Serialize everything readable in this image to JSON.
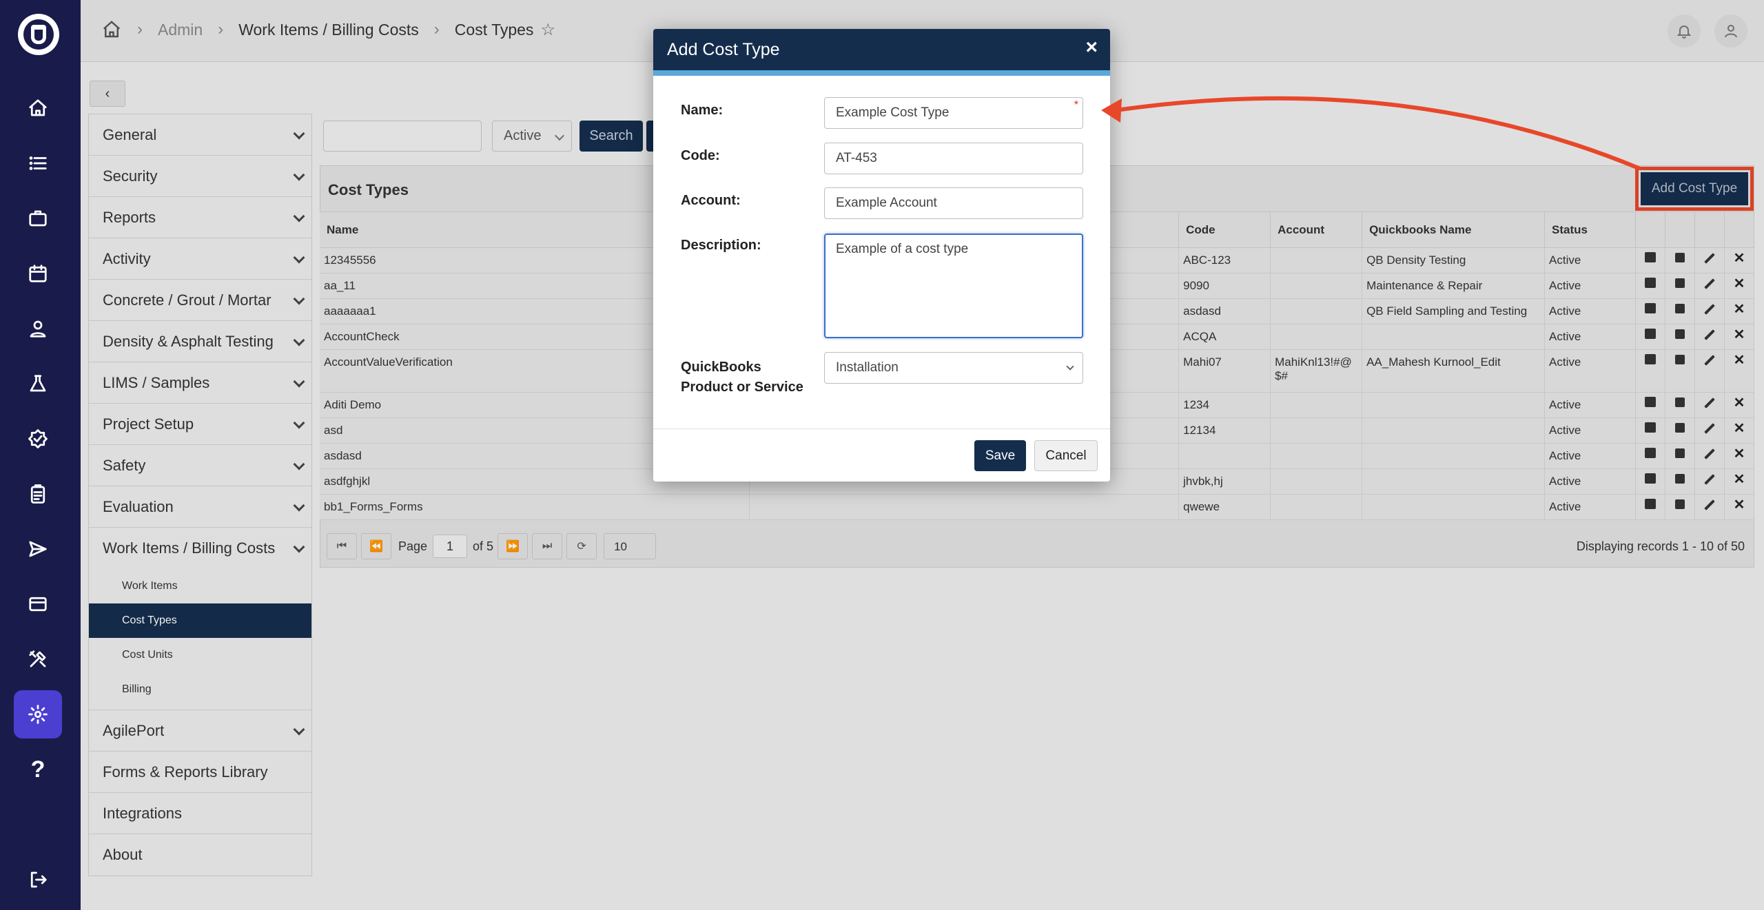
{
  "nav": {
    "items": [
      {
        "icon": "home-icon"
      },
      {
        "icon": "list-icon"
      },
      {
        "icon": "briefcase-icon"
      },
      {
        "icon": "calendar-icon"
      },
      {
        "icon": "person-badge-icon"
      },
      {
        "icon": "flask-icon"
      },
      {
        "icon": "check-badge-icon"
      },
      {
        "icon": "clipboard-icon"
      },
      {
        "icon": "send-icon"
      },
      {
        "icon": "credit-card-icon"
      },
      {
        "icon": "tools-icon"
      },
      {
        "icon": "gear-icon"
      },
      {
        "icon": "help-icon",
        "label": "?"
      },
      {
        "icon": "logout-icon"
      }
    ]
  },
  "breadcrumb": {
    "admin": "Admin",
    "section": "Work Items / Billing Costs",
    "current": "Cost Types"
  },
  "menu": {
    "items": [
      {
        "label": "General"
      },
      {
        "label": "Security"
      },
      {
        "label": "Reports"
      },
      {
        "label": "Activity"
      },
      {
        "label": "Concrete / Grout / Mortar"
      },
      {
        "label": "Density & Asphalt Testing"
      },
      {
        "label": "LIMS / Samples"
      },
      {
        "label": "Project Setup"
      },
      {
        "label": "Safety"
      },
      {
        "label": "Evaluation"
      },
      {
        "label": "Work Items / Billing Costs"
      }
    ],
    "subitems": [
      {
        "label": "Work Items"
      },
      {
        "label": "Cost Types"
      },
      {
        "label": "Cost Units"
      },
      {
        "label": "Billing"
      }
    ],
    "after": [
      {
        "label": "AgilePort"
      },
      {
        "label": "Forms & Reports Library"
      },
      {
        "label": "Integrations"
      },
      {
        "label": "About"
      }
    ]
  },
  "filters": {
    "status_value": "Active",
    "search_label": "Search"
  },
  "grid": {
    "title": "Cost Types",
    "add_button": "Add Cost Type",
    "columns": [
      "Name",
      "",
      "Code",
      "Account",
      "Quickbooks Name",
      "Status"
    ],
    "rows": [
      {
        "name": "12345556",
        "code": "ABC-123",
        "account": "",
        "qb": "QB Density Testing",
        "status": "Active"
      },
      {
        "name": "aa_11",
        "code": "9090",
        "account": "",
        "qb": "Maintenance & Repair",
        "status": "Active"
      },
      {
        "name": "aaaaaaa1",
        "code": "asdasd",
        "account": "",
        "qb": "QB Field Sampling and Testing",
        "status": "Active"
      },
      {
        "name": "AccountCheck",
        "code": "ACQA",
        "account": "",
        "qb": "",
        "status": "Active"
      },
      {
        "name": "AccountValueVerification",
        "code": "Mahi07",
        "account": "MahiKnl13!#@$#",
        "qb": "AA_Mahesh Kurnool_Edit",
        "status": "Active"
      },
      {
        "name": "Aditi Demo",
        "code": "1234",
        "account": "",
        "qb": "",
        "status": "Active"
      },
      {
        "name": "asd",
        "code": "12134",
        "account": "",
        "qb": "",
        "status": "Active"
      },
      {
        "name": "asdasd",
        "code": "",
        "account": "",
        "qb": "",
        "status": "Active"
      },
      {
        "name": "asdfghjkl",
        "code": "jhvbk,hj",
        "account": "",
        "qb": "",
        "status": "Active"
      },
      {
        "name": "bb1_Forms_Forms",
        "code": "qwewe",
        "account": "",
        "qb": "",
        "status": "Active"
      }
    ]
  },
  "pager": {
    "page_label": "Page",
    "page": "1",
    "of_label": "of 5",
    "page_size": "10",
    "records": "Displaying records 1 - 10 of 50"
  },
  "modal": {
    "title": "Add Cost Type",
    "close": "×",
    "name_label": "Name:",
    "name_value": "Example Cost Type",
    "required_mark": "*",
    "code_label": "Code:",
    "code_value": "AT-453",
    "account_label": "Account:",
    "account_value": "Example Account",
    "description_label": "Description:",
    "description_value": "Example of a cost type",
    "qb_label_1": "QuickBooks",
    "qb_label_2": "Product or Service",
    "qb_value": "Installation",
    "save": "Save",
    "cancel": "Cancel"
  },
  "colors": {
    "rail": "#191c4a",
    "navy": "#152d4d",
    "active_rail": "#4a3fd1",
    "annotation": "#e8472a"
  }
}
